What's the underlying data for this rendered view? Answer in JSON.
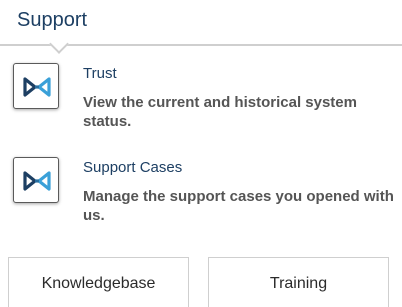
{
  "header": {
    "title": "Support"
  },
  "items": [
    {
      "title": "Trust",
      "description": "View the current and historical system status.",
      "icon": "bowtie-logo-icon"
    },
    {
      "title": "Support Cases",
      "description": "Manage the support cases you opened with us.",
      "icon": "bowtie-logo-icon"
    }
  ],
  "buttons": {
    "knowledgebase_label": "Knowledgebase",
    "training_label": "Training"
  },
  "colors": {
    "heading": "#1d3f63",
    "icon_dark": "#1d3f63",
    "icon_light": "#3aa0d8",
    "border": "#cfcfcf"
  }
}
